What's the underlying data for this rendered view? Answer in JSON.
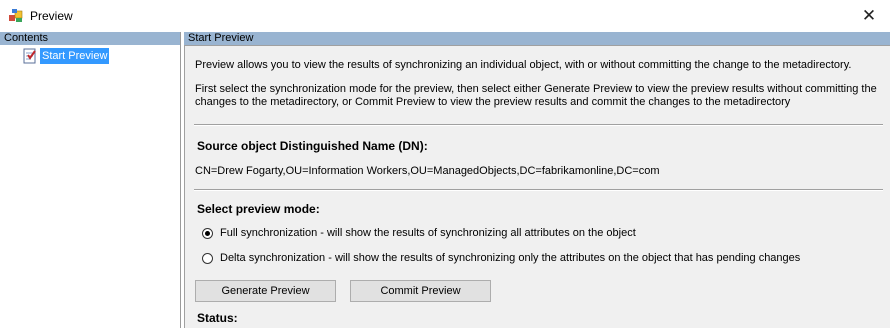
{
  "window": {
    "title": "Preview",
    "close_glyph": "✕"
  },
  "left_pane": {
    "header": "Contents",
    "tree": [
      {
        "label": "Start Preview",
        "icon": "preview-document-icon"
      }
    ]
  },
  "right_pane": {
    "header": "Start Preview",
    "intro": "Preview allows you to view the results of synchronizing an individual object, with or without committing the change to the metadirectory.",
    "instructions_line1": "First select the synchronization  mode for the preview, then select either Generate Preview to view the preview results without committing the",
    "instructions_line2": "changes to the metadirectory, or Commit Preview to view the preview results and commit the changes to the metadirectory",
    "dn_heading": "Source object Distinguished Name (DN):",
    "dn_value": "CN=Drew Fogarty,OU=Information Workers,OU=ManagedObjects,DC=fabrikamonline,DC=com",
    "mode_heading": "Select preview mode:",
    "modes": [
      {
        "label": "Full synchronization - will show the results of synchronizing all attributes on the object",
        "selected": true
      },
      {
        "label": "Delta synchronization - will show the results of synchronizing only the attributes on the object that has pending changes",
        "selected": false
      }
    ],
    "buttons": {
      "generate": "Generate Preview",
      "commit": "Commit Preview"
    },
    "status_label": "Status:"
  },
  "colors": {
    "header_bg": "#99b4d1",
    "selection_bg": "#3399ff",
    "panel_bg": "#f0f0f0"
  }
}
